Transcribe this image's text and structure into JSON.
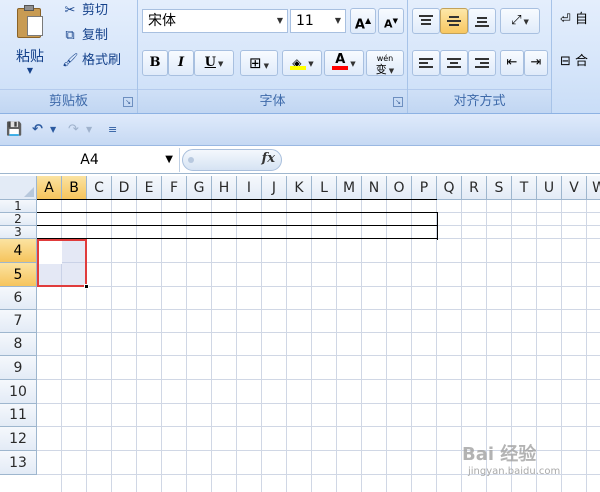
{
  "ribbon": {
    "clipboard": {
      "paste_label": "粘贴",
      "cut_label": "剪切",
      "copy_label": "复制",
      "format_painter_label": "格式刷",
      "group_label": "剪贴板"
    },
    "font": {
      "font_name": "宋体",
      "font_size": "11",
      "grow_label": "A",
      "shrink_label": "A",
      "bold_label": "B",
      "italic_label": "I",
      "underline_label": "U",
      "font_color_label": "A",
      "phonetic_label": "wén",
      "phonetic_char": "变",
      "group_label": "字体",
      "fill_color": "#ffff00",
      "font_color": "#ff0000"
    },
    "alignment": {
      "group_label": "对齐方式"
    },
    "wrap": {
      "wrap_label": "自",
      "merge_label": "合"
    }
  },
  "formula_bar": {
    "name_box": "A4",
    "fx_label": "fx"
  },
  "sheet": {
    "columns": [
      "A",
      "B",
      "C",
      "D",
      "E",
      "F",
      "G",
      "H",
      "I",
      "J",
      "K",
      "L",
      "M",
      "N",
      "O",
      "P",
      "Q",
      "R",
      "S",
      "T",
      "U",
      "V",
      "W"
    ],
    "rows": [
      "1",
      "2",
      "3",
      "4",
      "5",
      "6",
      "7",
      "8",
      "9",
      "10",
      "11",
      "12",
      "13"
    ],
    "selected_columns": [
      "A",
      "B"
    ],
    "selected_rows": [
      "4",
      "5"
    ],
    "active_cell": "A4"
  },
  "watermark": {
    "main": "Bai 经验",
    "sub": "jingyan.baidu.com"
  },
  "colors": {
    "selection_border": "#e03c3c",
    "header_selected": "#f6c45c"
  }
}
